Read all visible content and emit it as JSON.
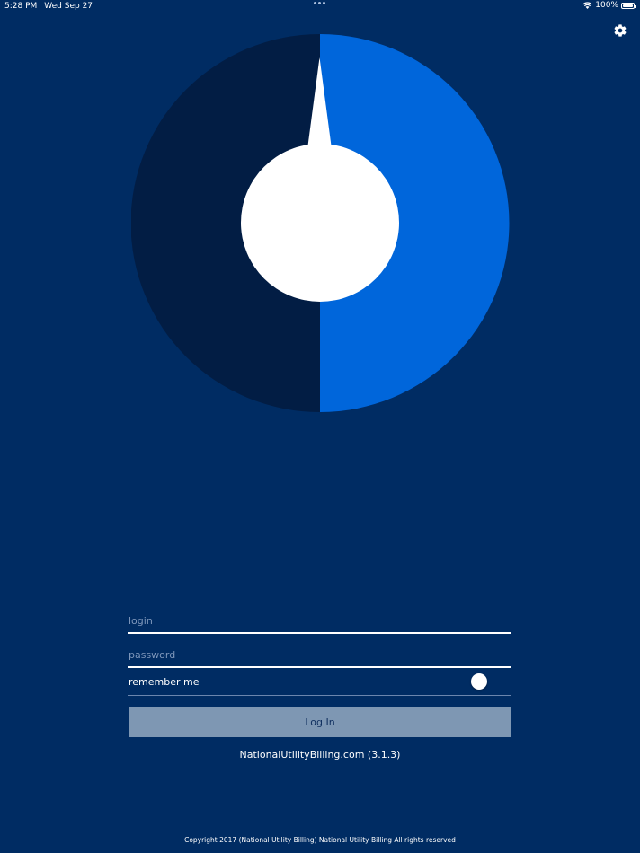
{
  "status_bar": {
    "time": "5:28 PM",
    "date": "Wed Sep 27",
    "battery": "100%",
    "wifi_icon": "wifi-icon",
    "battery_icon": "battery-full-icon"
  },
  "header": {
    "settings_icon": "gear-icon"
  },
  "logo": {
    "icon": "national-utility-billing-logo",
    "colors": {
      "left_half": "#021d44",
      "right_half": "#0066db",
      "center": "#ffffff"
    }
  },
  "form": {
    "login_placeholder": "login",
    "login_value": "",
    "password_placeholder": "password",
    "password_value": "",
    "remember_label": "remember me",
    "remember_on": false,
    "login_button_label": "Log In"
  },
  "footer": {
    "version": "NationalUtilityBilling.com (3.1.3)",
    "copyright": "Copyright 2017 (National Utility Billing) National Utility Billing All rights reserved"
  },
  "colors": {
    "background": "#002c63",
    "button": "#7e97b3",
    "button_text": "#0e2e5e",
    "placeholder": "#7e97bb"
  }
}
